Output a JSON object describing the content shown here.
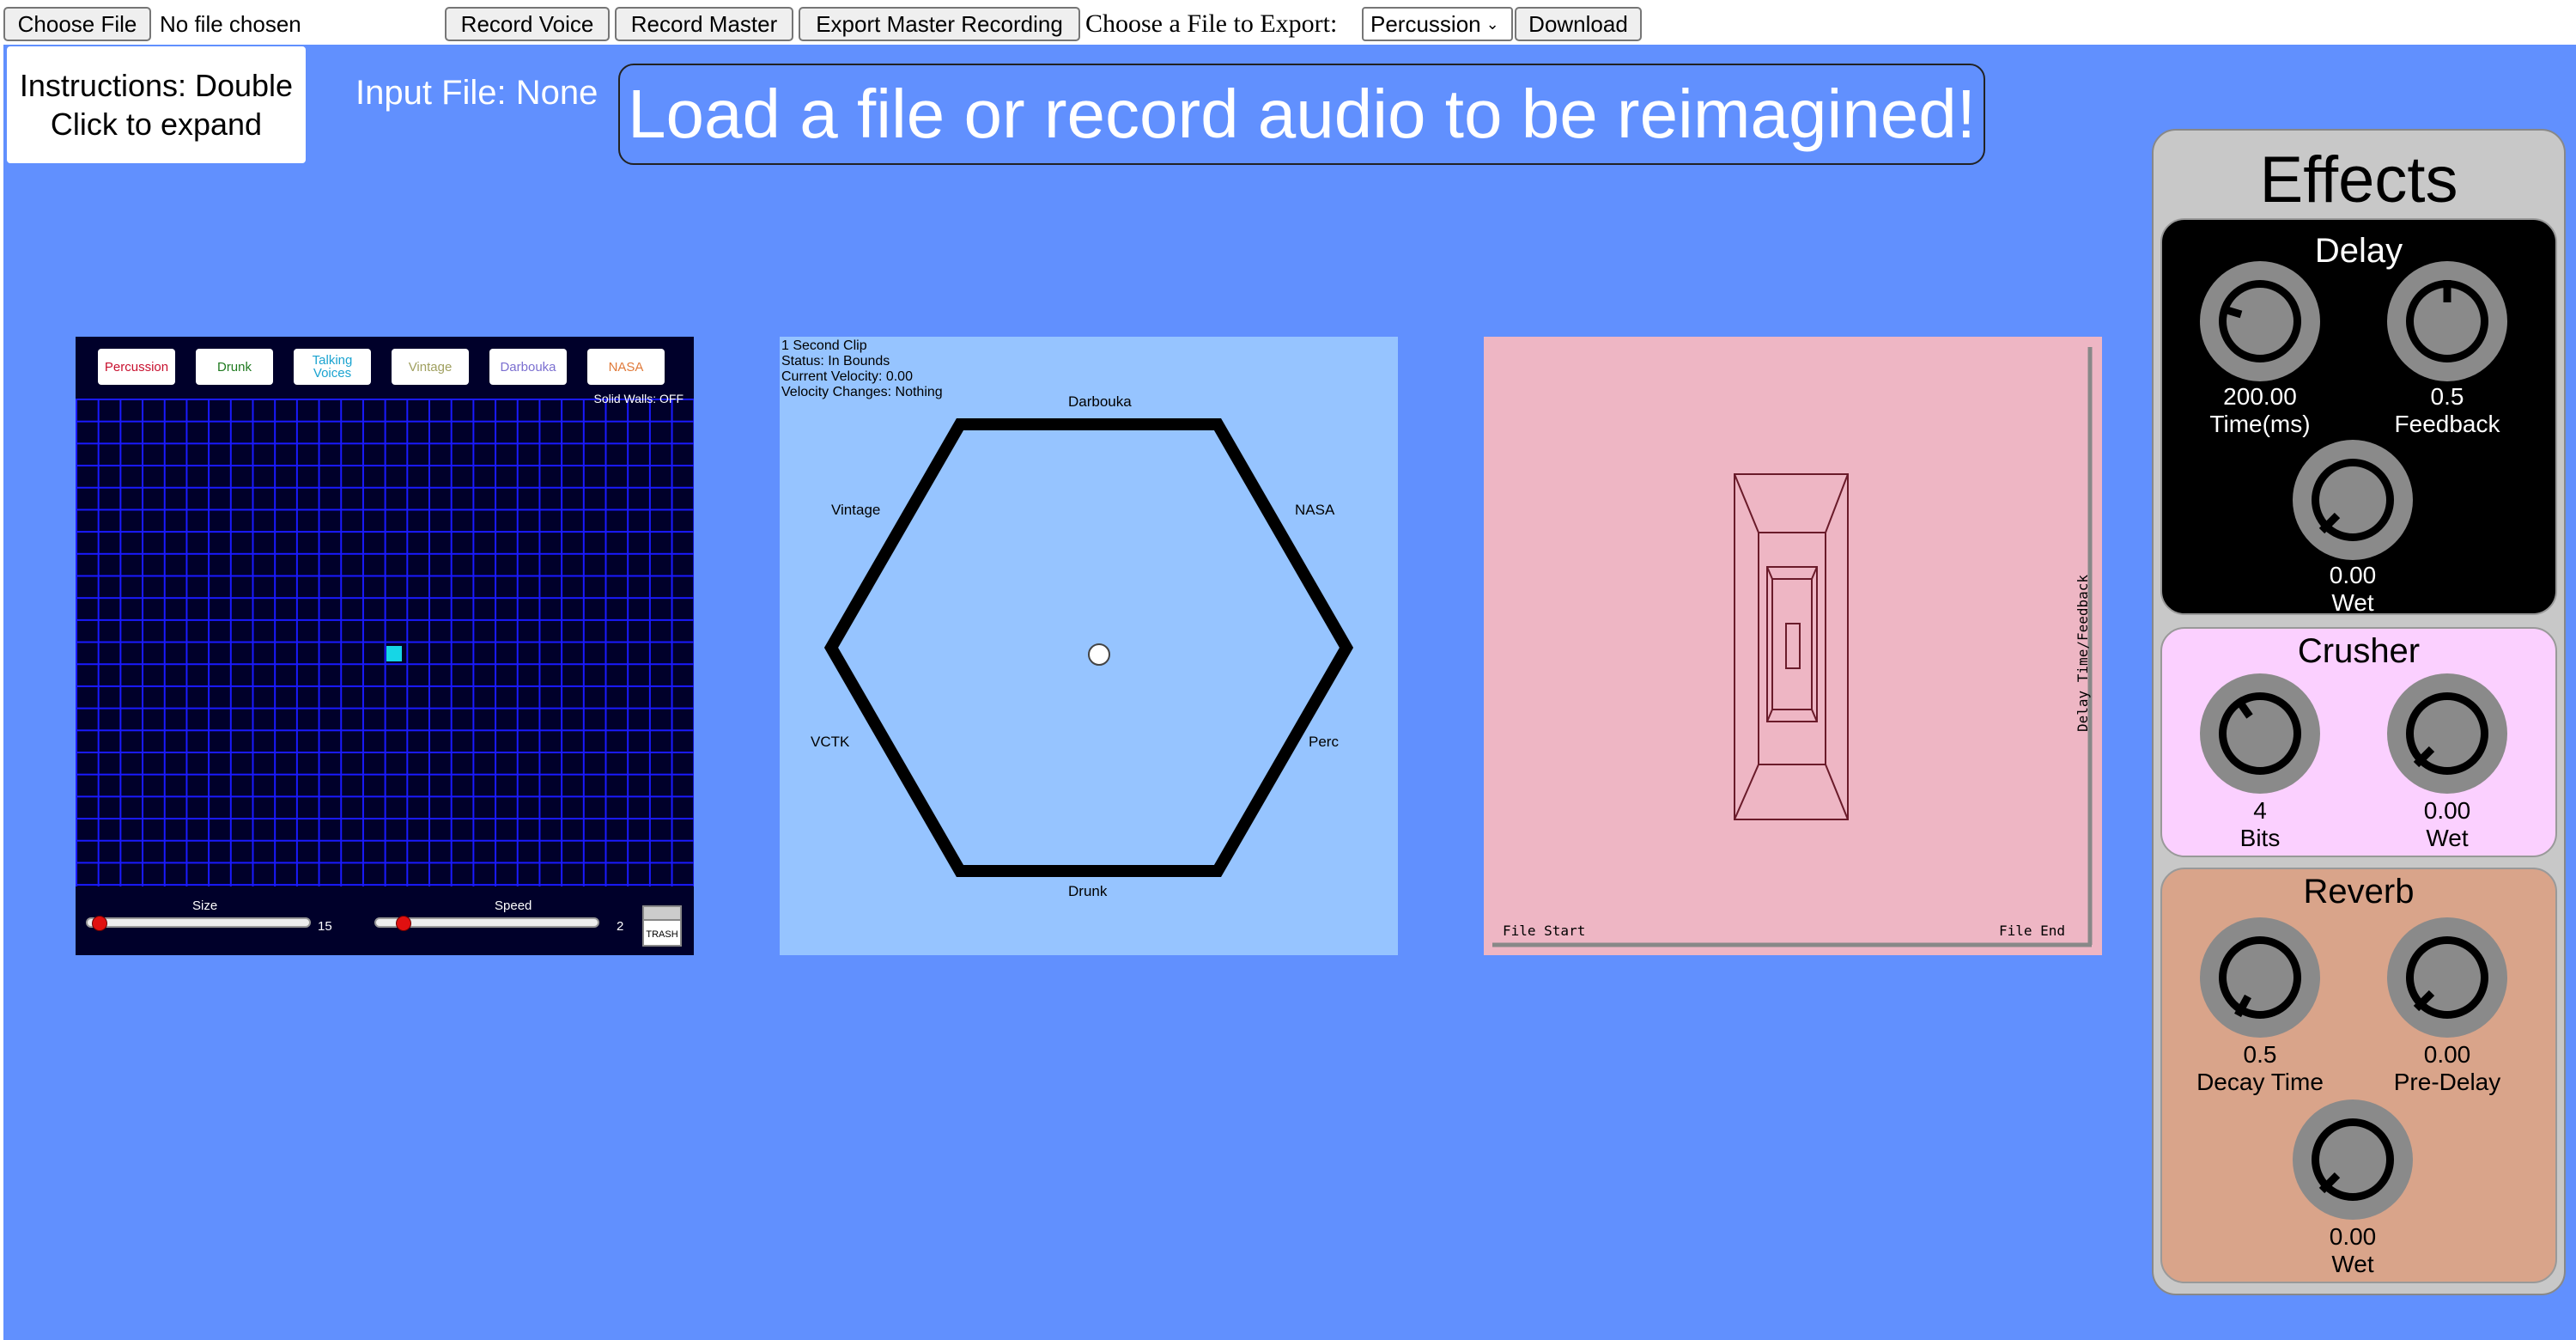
{
  "toolbar": {
    "choose_file": "Choose File",
    "no_file": "No file chosen",
    "record_voice": "Record Voice",
    "record_master": "Record Master",
    "export_master": "Export Master Recording",
    "choose_export_label": "Choose a File to Export:",
    "export_select": "Percussion",
    "download": "Download"
  },
  "instructions": "Instructions: Double Click to expand",
  "input_file": "Input File: None",
  "banner": "Load a file or record audio to be reimagined!",
  "grid": {
    "samples": [
      {
        "label": "Percussion",
        "color": "#c8102e"
      },
      {
        "label": "Drunk",
        "color": "#1f7a1f"
      },
      {
        "label": "Talking Voices",
        "color": "#1aa3d0"
      },
      {
        "label": "Vintage",
        "color": "#a0a060"
      },
      {
        "label": "Darbouka",
        "color": "#7b6fd0"
      },
      {
        "label": "NASA",
        "color": "#e07a3a"
      }
    ],
    "solid_walls": "Solid Walls: OFF",
    "size_label": "Size",
    "size_value": "15",
    "size_level": 0.03,
    "speed_label": "Speed",
    "speed_value": "2",
    "speed_level": 0.1,
    "trash": "TRASH",
    "accent": "#16d6e6"
  },
  "hex": {
    "status_lines": [
      "1 Second Clip",
      "Status: In Bounds",
      "Current Velocity: 0.00",
      "Velocity Changes: Nothing"
    ],
    "labels": {
      "top": "Darbouka",
      "top_right": "NASA",
      "right": "Perc",
      "bottom": "Drunk",
      "left": "VCTK",
      "top_left": "Vintage"
    }
  },
  "pad": {
    "y_label": "Delay Time/Feedback",
    "x_start": "File Start",
    "x_end": "File End"
  },
  "effects": {
    "title": "Effects",
    "delay": {
      "name": "Delay",
      "time_value": "200.00",
      "time_label": "Time(ms)",
      "feedback_value": "0.5",
      "feedback_label": "Feedback",
      "wet_value": "0.00",
      "wet_label": "Wet"
    },
    "crusher": {
      "name": "Crusher",
      "bits_value": "4",
      "bits_label": "Bits",
      "wet_value": "0.00",
      "wet_label": "Wet"
    },
    "reverb": {
      "name": "Reverb",
      "decay_value": "0.5",
      "decay_label": "Decay Time",
      "predelay_value": "0.00",
      "predelay_label": "Pre-Delay",
      "wet_value": "0.00",
      "wet_label": "Wet"
    }
  }
}
